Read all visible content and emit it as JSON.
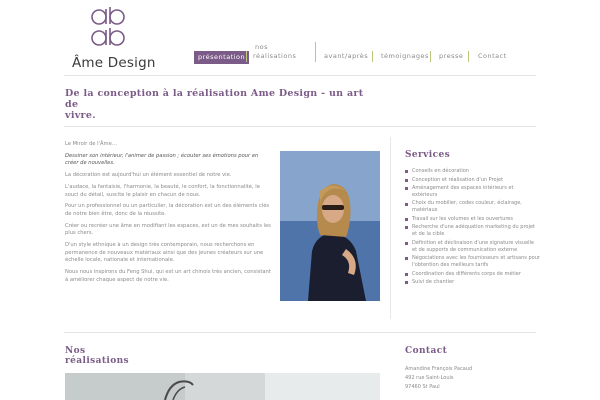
{
  "brand": {
    "logo_text": "Âme Design"
  },
  "nav": {
    "items": [
      {
        "label": "présentation"
      },
      {
        "label": "nos"
      },
      {
        "label": "réalisations"
      },
      {
        "label": "avant/après"
      },
      {
        "label": "témoignages"
      },
      {
        "label": "presse"
      },
      {
        "label": "Contact"
      }
    ]
  },
  "page": {
    "title_line1": "De la conception à la réalisation Ame Design - un art de",
    "title_line2": "vivre."
  },
  "content": {
    "paragraphs": [
      "Le Miroir de l'Âme…",
      "Dessiner son intérieur, l'animer de passion ; écouter ses émotions pour en créer de nouvelles.",
      "La décoration est aujourd'hui un élément essentiel de notre vie.",
      "L'audace, la fantaisie, l'harmonie, la beauté, le confort, la fonctionnalité, le souci du détail, suscite le plaisir en chacun de nous.",
      "Pour un professionnel ou un particulier, la décoration est un des éléments clés de notre bien être, donc de la réussite.",
      "Créer ou recréer une âme en modifiant les espaces, est un de mes souhaits les plus chers.",
      "D'un style ethnique à un design très contemporain, nous recherchons en permanence de nouveaux matériaux ainsi que des jeunes créateurs sur une échelle locale, nationale et internationale.",
      "Nous nous inspirons du Feng Shui, qui est un art chinois très ancien, consistant à améliorer chaque aspect de notre vie."
    ]
  },
  "services": {
    "title": "Services",
    "items": [
      "Conseils en décoration",
      "Conception et réalisation d'un Projet",
      "Aménagement des espaces intérieurs et extérieurs",
      "Choix du mobilier, codes couleur, éclairage, matériaux",
      "Travail sur les volumes et les ouvertures",
      "Recherche d'une adéquation marketing du projet et de la cible",
      "Définition et déclinaison d'une signature visuelle et de supports de communication externe",
      "Négociations avec les fournisseurs et artisans pour l'obtention des meilleurs tarifs",
      "Coordination des différents corps de métier",
      "Suivi de chantier"
    ]
  },
  "realisations": {
    "title_line1": "Nos",
    "title_line2": "réalisations"
  },
  "contact": {
    "title": "Contact",
    "name": "Amandine François Pacaud",
    "address1": "492 rue Saint-Louis",
    "address2": "97460 St Paul"
  },
  "colors": {
    "accent": "#7b5b87",
    "nav_separator": "#b7c97c"
  }
}
